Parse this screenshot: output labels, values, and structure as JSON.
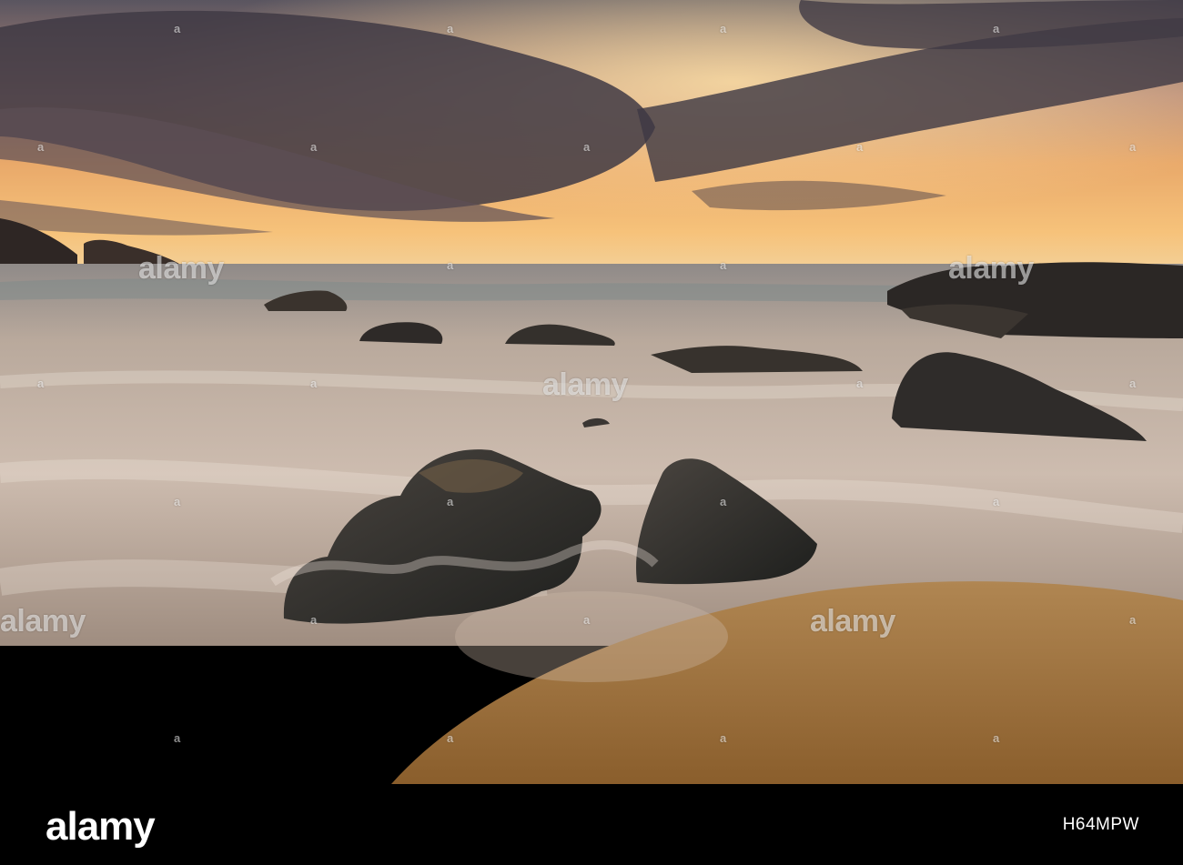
{
  "photo": {
    "subject": "sunset-seascape",
    "colors": {
      "sky_warm": "#f3b66d",
      "sky_cloud": "#4a4550",
      "sea": "#bfae9f",
      "sand": "#a87a3e",
      "rock": "#2a2a28"
    }
  },
  "watermark": {
    "center": "alamy",
    "left": "alamy",
    "right": "alamy",
    "top_left": "alamy",
    "small_mark": "a"
  },
  "footer": {
    "logo": "alamy",
    "image_id": "H64MPW"
  }
}
